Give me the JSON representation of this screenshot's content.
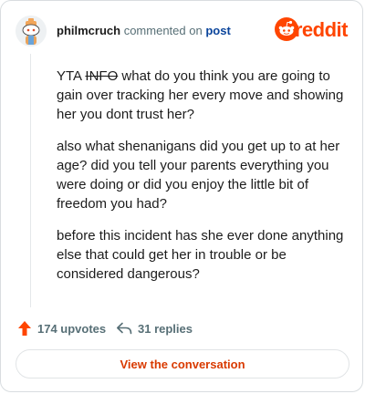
{
  "header": {
    "username": "philmcruch",
    "action": "commented on",
    "post_link": "post",
    "brand": "reddit",
    "avatar_icon": "snoo-avatar-icon",
    "brand_icon": "reddit-snoo-icon"
  },
  "comment": {
    "p1_lead": "YTA ",
    "p1_struck": "INFO",
    "p1_rest": " what do you think you are going to gain over tracking her every move and showing her you dont trust her?",
    "p2": "also what shenanigans did you get up to at her age? did you tell your parents everything you were doing or did you enjoy the little bit of freedom you had?",
    "p3": "before this incident has she ever done anything else that could get her in trouble or be considered dangerous?"
  },
  "footer": {
    "upvotes": "174 upvotes",
    "replies": "31 replies",
    "upvote_icon": "upvote-arrow-icon",
    "reply_icon": "reply-icon"
  },
  "cta": {
    "label": "View the conversation"
  },
  "colors": {
    "brand": "#ff4500",
    "cta_text": "#d93a00",
    "link": "#0a449b",
    "muted": "#576f76"
  }
}
